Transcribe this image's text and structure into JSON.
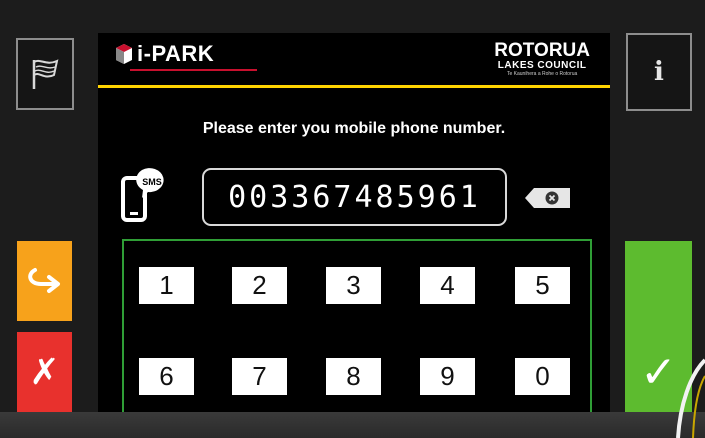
{
  "header": {
    "brand": "i-PARK",
    "council_name": "ROTORUA",
    "council_sub": "LAKES COUNCIL",
    "council_tagline": "Te Kaunihera a Rohe o Rotorua"
  },
  "prompt": "Please enter you mobile phone number.",
  "sms_badge": "SMS",
  "phone_field": {
    "value": "003367485961"
  },
  "keypad": {
    "keys": [
      "1",
      "2",
      "3",
      "4",
      "5",
      "6",
      "7",
      "8",
      "9",
      "0"
    ]
  },
  "side_buttons": {
    "info_label": "i",
    "back_icon": "return-arrow-icon",
    "cancel_label": "✗",
    "confirm_label": "✓",
    "language_icon": "flag-icon"
  },
  "colors": {
    "accent_yellow": "#ffd400",
    "back_orange": "#f7a21b",
    "cancel_red": "#e8312d",
    "confirm_green": "#5dbb2f",
    "keypad_border": "#2f9e36"
  }
}
